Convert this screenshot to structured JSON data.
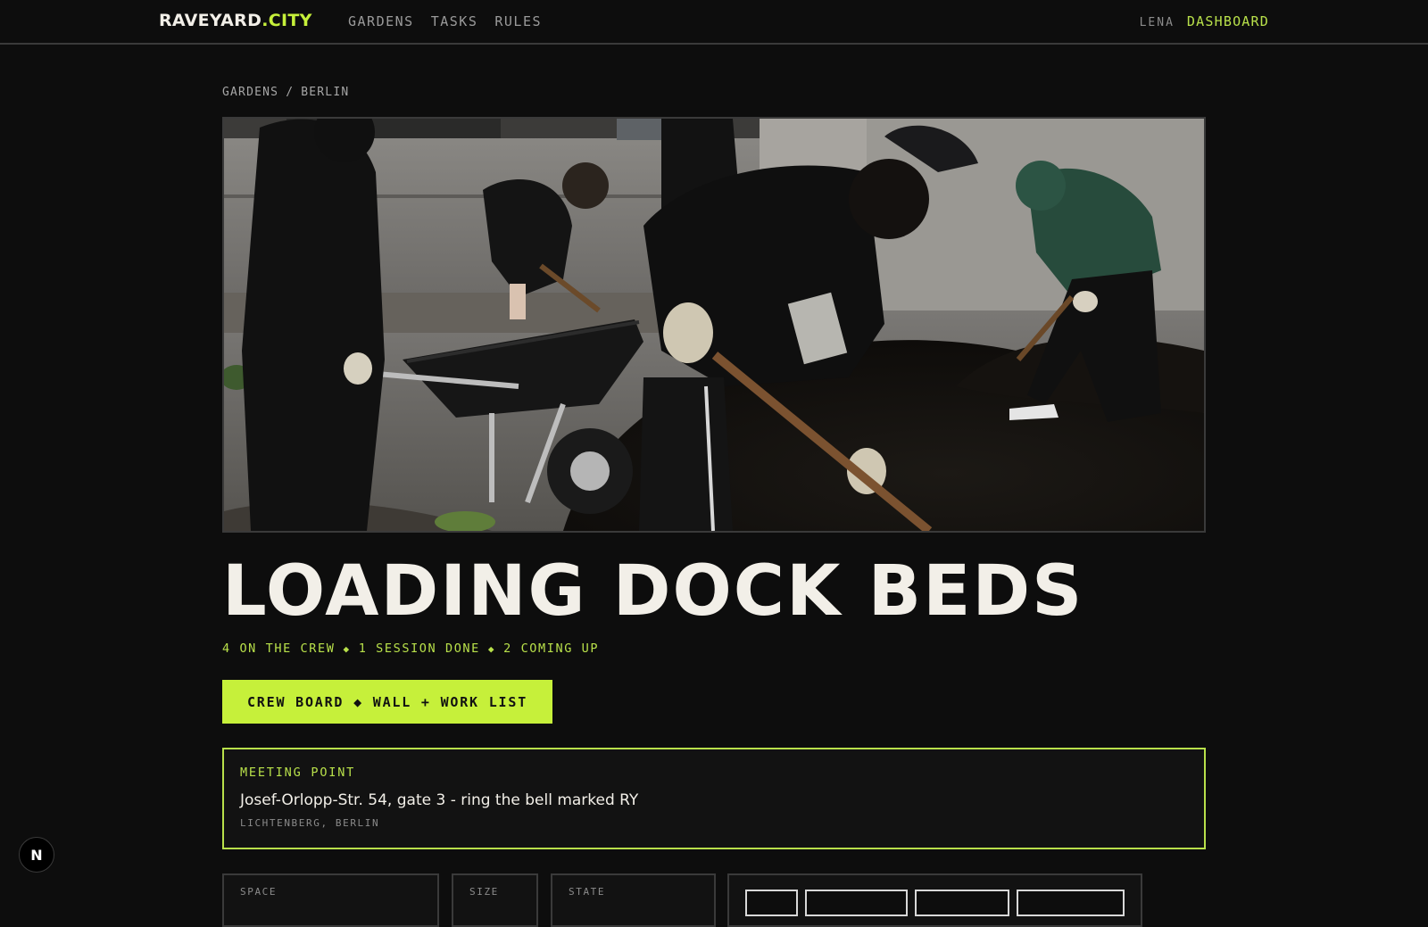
{
  "nav": {
    "brand_main": "RAVEYARD",
    "brand_suffix": ".CITY",
    "links": [
      "GARDENS",
      "TASKS",
      "RULES"
    ],
    "user": "LENA",
    "dashboard": "DASHBOARD"
  },
  "breadcrumb": {
    "root": "GARDENS",
    "separator": "/",
    "current": "BERLIN"
  },
  "hero": {
    "image_description": "Volunteers shoveling soil into a wheelbarrow in a courtyard"
  },
  "garden": {
    "title": "LOADING DOCK BEDS",
    "stats": [
      "4 ON THE CREW",
      "1 SESSION DONE",
      "2 COMING UP"
    ],
    "stats_separator": "◆"
  },
  "cta": {
    "label": "CREW BOARD ◆ WALL + WORK LIST"
  },
  "meeting": {
    "label": "MEETING POINT",
    "address": "Josef-Orlopp-Str. 54, gate 3 - ring the bell marked RY",
    "district": "LICHTENBERG, BERLIN"
  },
  "info": {
    "space_label": "SPACE",
    "size_label": "SIZE",
    "state_label": "STATE"
  },
  "badge": {
    "label": "N"
  },
  "colors": {
    "accent": "#c6f03a",
    "accent_text": "#b8e04a",
    "background": "#0d0d0d",
    "text": "#f2efe8"
  }
}
